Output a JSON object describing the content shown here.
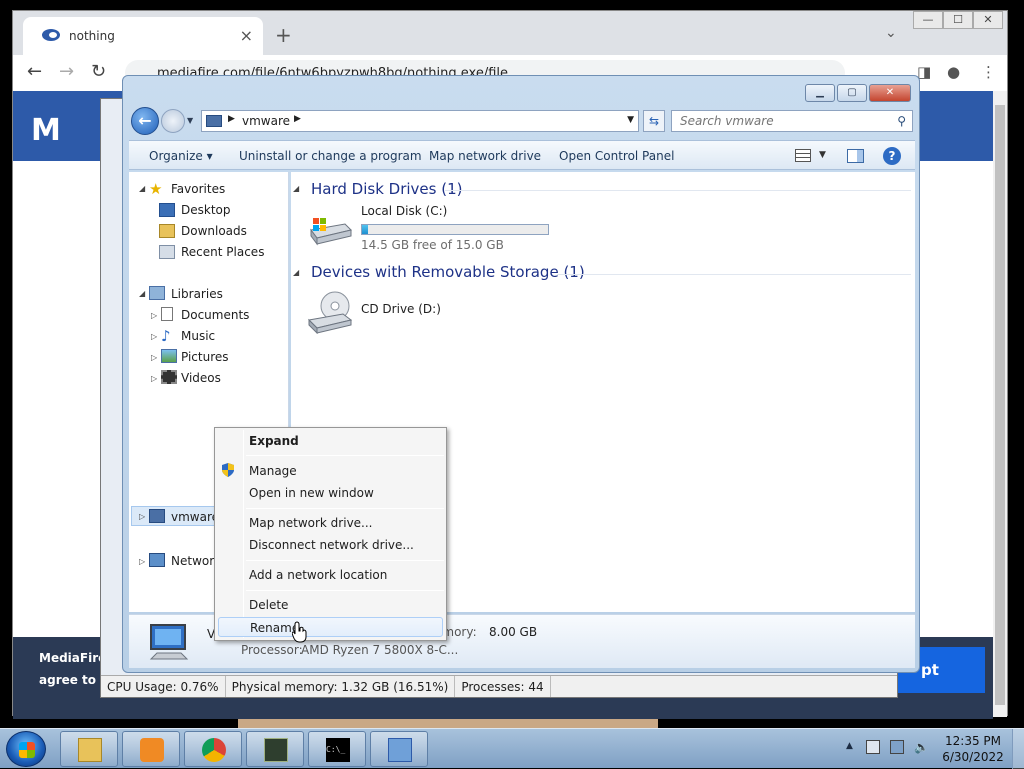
{
  "chrome": {
    "tab_title": "nothing",
    "tab_close": "×",
    "new_tab": "+",
    "tabs_menu": "⌄",
    "back": "←",
    "forward": "→",
    "reload": "↻",
    "url": "mediafire.com/file/6ntw6bpyzpwh8bg/nothing.exe/file",
    "win_min": "—",
    "win_max": "☐",
    "win_close": "✕"
  },
  "mediafire": {
    "logo": "M",
    "cookie_line1": "MediaFire",
    "cookie_line2": "agree to ou",
    "accept": "pt"
  },
  "taskmgr_status": {
    "cpu": "CPU Usage: 0.76%",
    "memory": "Physical memory: 1.32 GB (16.51%)",
    "processes": "Processes: 44"
  },
  "explorer": {
    "address": "vmware",
    "search_placeholder": "Search vmware",
    "commands": {
      "organize": "Organize ▾",
      "uninstall": "Uninstall or change a program",
      "map_drive": "Map network drive",
      "control_panel": "Open Control Panel"
    },
    "nav": {
      "favorites": "Favorites",
      "desktop": "Desktop",
      "downloads": "Downloads",
      "recent": "Recent Places",
      "libraries": "Libraries",
      "documents": "Documents",
      "music": "Music",
      "pictures": "Pictures",
      "videos": "Videos",
      "vmware": "vmware",
      "network": "Network"
    },
    "groups": {
      "hdd": "Hard Disk Drives (1)",
      "removable": "Devices with Removable Storage (1)"
    },
    "drives": {
      "c_name": "Local Disk (C:)",
      "c_free": "14.5 GB free of 15.0 GB",
      "c_used_fraction": 0.033,
      "d_name": "CD Drive (D:)"
    },
    "details": {
      "name": "V",
      "memory_label": "emory:",
      "memory_value": "8.00 GB",
      "processor_label": "Processor:",
      "processor_value": "AMD Ryzen 7 5800X 8-C..."
    }
  },
  "context_menu": {
    "expand": "Expand",
    "manage": "Manage",
    "open_new_window": "Open in new window",
    "map_network_drive": "Map network drive...",
    "disconnect_network_drive": "Disconnect network drive...",
    "add_network_location": "Add a network location",
    "delete": "Delete",
    "rename": "Rename"
  },
  "taskbar": {
    "time": "12:35 PM",
    "date": "6/30/2022",
    "cmd_glyph": "C:\\_"
  }
}
